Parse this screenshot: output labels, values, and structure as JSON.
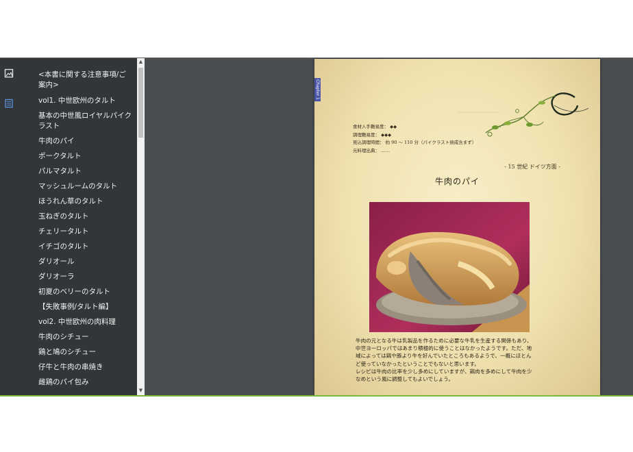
{
  "toc": {
    "items": [
      "<本書に関する注意事項/ご案内>",
      "vol1. 中世欧州のタルト",
      "基本の中世風ロイヤルパイクラスト",
      "牛肉のパイ",
      "ポークタルト",
      "パルマタルト",
      "マッシュルームのタルト",
      "ほうれん草のタルト",
      "玉ねぎのタルト",
      "チェリータルト",
      "イチゴのタルト",
      "ダリオール",
      "ダリオーラ",
      "初夏のベリーのタルト",
      "【失敗事例/タルト編】",
      "vol2. 中世欧州の肉料理",
      "牛肉のシチュー",
      "鶏と鳩のシチュー",
      "仔牛と牛肉の串焼き",
      "雌鶏のパイ包み"
    ]
  },
  "sidebar_icons": [
    "image-icon",
    "list-icon"
  ],
  "page": {
    "chapter_tab": "Chapter 1",
    "meta": [
      "食材入手難易度： ◆◆",
      "調理難易度： ◆◆◆",
      "見込調理時間： 約 90 ～ 110 分（パイクラスト焼成含まず）",
      "元料理出典： ……"
    ],
    "era": "- 15 世紀 ドイツ方面 -",
    "title": "牛肉のパイ",
    "description": [
      "牛肉の元となる牛は乳製品を作るために必要な牛乳を生産する関係もあり、",
      "中世ヨーロッパではあまり積極的に使うことはなかったようです。ただ、地",
      "域によっては鶏や豚より牛を好んでいたところもあるようで、一概にほとん",
      "ど使っていなかったということでもないと思います。",
      "レシピは牛肉の比率を少し多めにしていますが、鶏肉を多めにして牛肉を少",
      "なめという風に調整してもよいでしょう。"
    ]
  },
  "colors": {
    "sidebar_bg": "#323639",
    "viewer_bg": "#4a4e51",
    "accent_line": "#7ab83a",
    "chapter_tab": "#4a55a8"
  }
}
